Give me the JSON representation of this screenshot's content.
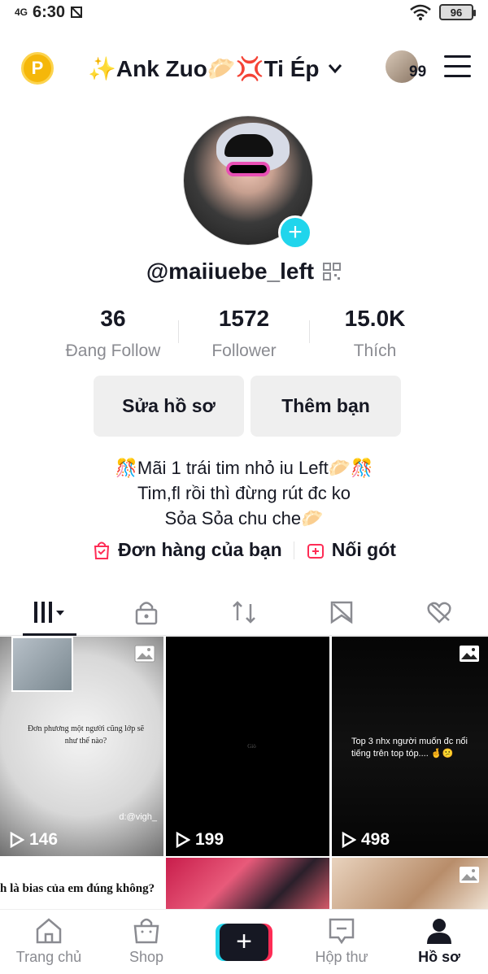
{
  "status_bar": {
    "network": "4G",
    "time": "6:30",
    "battery": "96"
  },
  "header": {
    "coin_label": "P",
    "title": "✨Ank Zuo🥟💢Ti Ép",
    "notif_count": "99"
  },
  "profile": {
    "username": "@maiiuebe_left",
    "add_label": "+"
  },
  "stats": [
    {
      "value": "36",
      "label": "Đang Follow"
    },
    {
      "value": "1572",
      "label": "Follower"
    },
    {
      "value": "15.0K",
      "label": "Thích"
    }
  ],
  "actions": {
    "edit_profile": "Sửa hồ sơ",
    "add_friend": "Thêm bạn"
  },
  "bio": [
    "🎊Mãi 1 trái tim nhỏ iu Left🥟🎊",
    "Tim,fl rồi thì đừng rút đc ko",
    "Sỏa Sỏa chu che🥟"
  ],
  "shop": {
    "orders": "Đơn hàng của bạn",
    "add": "Nối gót"
  },
  "tabs": [
    "videos-tab",
    "private-tab",
    "repost-tab",
    "favorites-tab",
    "liked-tab"
  ],
  "grid": [
    {
      "caption": "Đơn phương một người cũng lớp sẽ như thế nào?",
      "watermark": "d:@vigh_",
      "views": "146"
    },
    {
      "caption": "Giò",
      "views": "199"
    },
    {
      "caption": "Top 3 nhx người muốn đc nổi tiếng trên top tóp.... 🤞😕",
      "views": "498"
    },
    {
      "caption": "h là bias của em đúng không?"
    }
  ],
  "bottom_nav": {
    "home": "Trang chủ",
    "shop": "Shop",
    "inbox": "Hộp thư",
    "profile": "Hồ sơ",
    "create": "+"
  },
  "colors": {
    "accent_cyan": "#20d5ec",
    "accent_red": "#fe2c55",
    "coin": "#f5b70a"
  }
}
